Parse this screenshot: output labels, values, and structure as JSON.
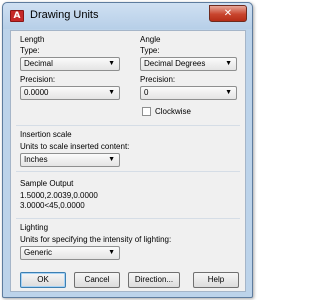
{
  "window": {
    "title": "Drawing Units"
  },
  "length": {
    "section_label": "Length",
    "type_label": "Type:",
    "type_value": "Decimal",
    "precision_label": "Precision:",
    "precision_value": "0.0000"
  },
  "angle": {
    "section_label": "Angle",
    "type_label": "Type:",
    "type_value": "Decimal Degrees",
    "precision_label": "Precision:",
    "precision_value": "0",
    "clockwise_label": "Clockwise",
    "clockwise_checked": false
  },
  "insertion": {
    "section_label": "Insertion scale",
    "units_label": "Units to scale inserted content:",
    "units_value": "Inches"
  },
  "sample": {
    "section_label": "Sample Output",
    "line1": "1.5000,2.0039,0.0000",
    "line2": "3.0000<45,0.0000"
  },
  "lighting": {
    "section_label": "Lighting",
    "units_label": "Units for specifying the intensity of lighting:",
    "units_value": "Generic"
  },
  "buttons": {
    "ok": "OK",
    "cancel": "Cancel",
    "direction": "Direction...",
    "help": "Help"
  },
  "icons": {
    "app": "autocad-app-icon",
    "close": "close-icon",
    "dropdown": "chevron-down-icon"
  },
  "colors": {
    "title_bar": "#bcd3ea",
    "close_button": "#c9452e",
    "client_bg": "#f0f0f0"
  }
}
